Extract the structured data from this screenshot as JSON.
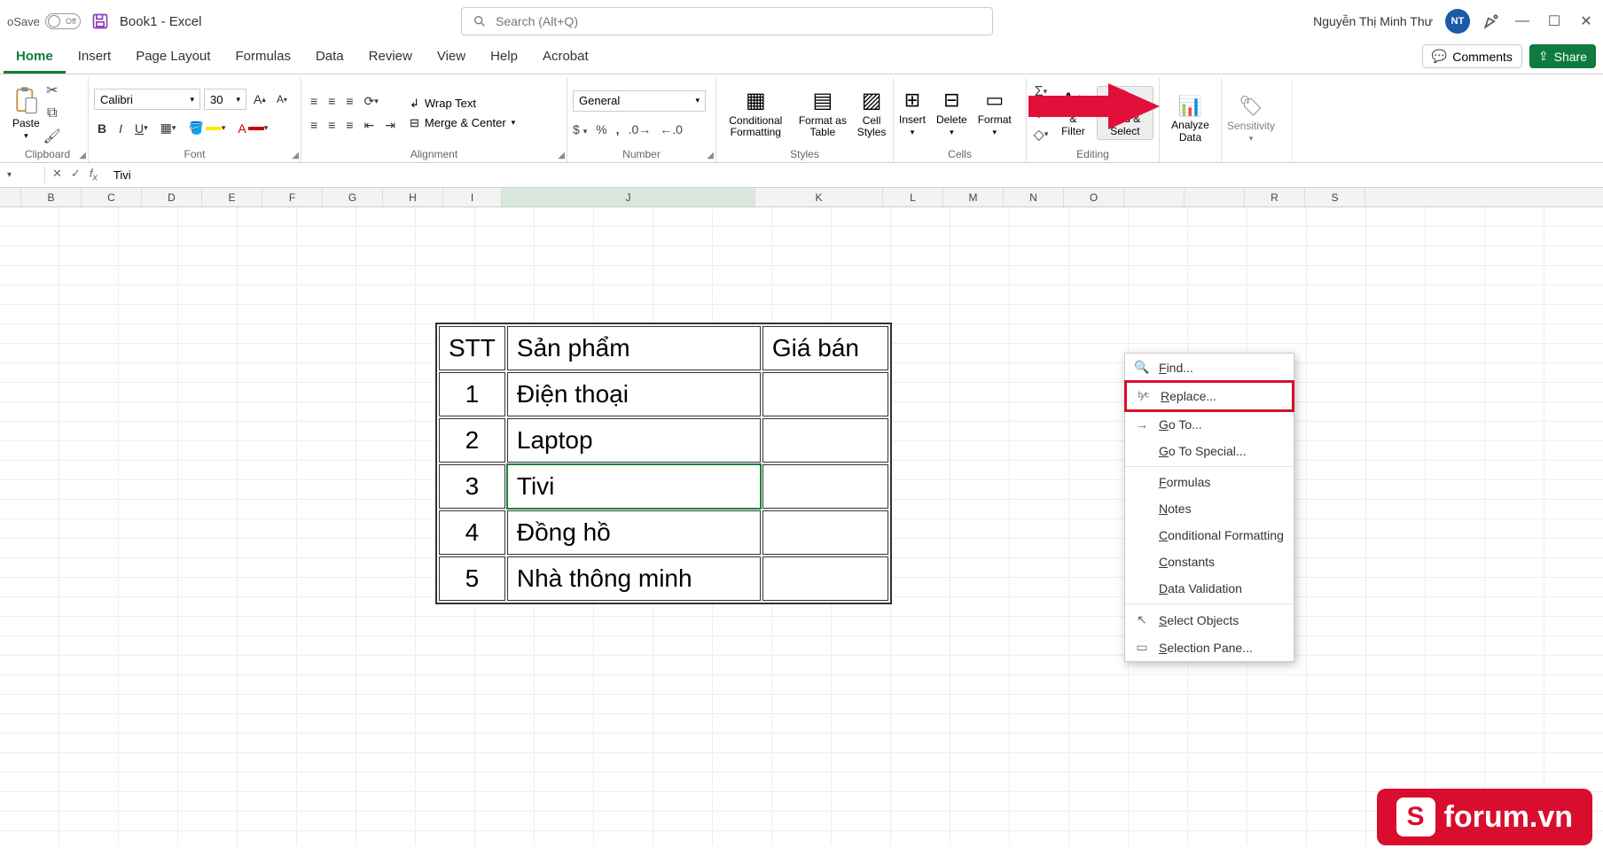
{
  "titlebar": {
    "autosave_label": "oSave",
    "autosave_state": "Off",
    "filename": "Book1  -  Excel",
    "search_placeholder": "Search (Alt+Q)",
    "user_name": "Nguyễn Thị Minh Thư",
    "user_initials": "NT"
  },
  "tabs": {
    "items": [
      "Home",
      "Insert",
      "Page Layout",
      "Formulas",
      "Data",
      "Review",
      "View",
      "Help",
      "Acrobat"
    ],
    "active": "Home",
    "comments": "Comments",
    "share": "Share"
  },
  "ribbon": {
    "clipboard": {
      "paste": "Paste",
      "label": "Clipboard"
    },
    "font": {
      "name": "Calibri",
      "size": "30",
      "label": "Font"
    },
    "alignment": {
      "wrap": "Wrap Text",
      "merge": "Merge & Center",
      "label": "Alignment"
    },
    "number": {
      "format": "General",
      "label": "Number"
    },
    "styles": {
      "cond": "Conditional Formatting",
      "table": "Format as Table",
      "cell": "Cell Styles",
      "label": "Styles"
    },
    "cells": {
      "insert": "Insert",
      "delete": "Delete",
      "format": "Format",
      "label": "Cells"
    },
    "editing": {
      "sort": "& Filter",
      "find": "Find & Select",
      "label": "Editing"
    },
    "analysis": {
      "analyze": "Analyze Data"
    },
    "sensitivity": {
      "label": "Sensitivity"
    }
  },
  "formula_bar": {
    "cell_value": "Tivi"
  },
  "columns": [
    "B",
    "C",
    "D",
    "E",
    "F",
    "G",
    "H",
    "I",
    "J",
    "K",
    "L",
    "M",
    "N",
    "O",
    "",
    "",
    "R",
    "S"
  ],
  "active_col_start": "I",
  "active_col_end": "J",
  "table": {
    "headers": {
      "stt": "STT",
      "prod": "Sản phẩm",
      "price": "Giá bán"
    },
    "rows": [
      {
        "stt": "1",
        "prod": "Điện thoại",
        "price": ""
      },
      {
        "stt": "2",
        "prod": "Laptop",
        "price": ""
      },
      {
        "stt": "3",
        "prod": "Tivi",
        "price": ""
      },
      {
        "stt": "4",
        "prod": "Đồng hồ",
        "price": ""
      },
      {
        "stt": "5",
        "prod": "Nhà thông minh",
        "price": ""
      }
    ],
    "selected_row_index": 2
  },
  "dropdown": {
    "items": [
      {
        "icon": "search",
        "label": "Find..."
      },
      {
        "icon": "replace",
        "label": "Replace...",
        "highlight": true
      },
      {
        "icon": "goto",
        "label": "Go To..."
      },
      {
        "icon": "",
        "label": "Go To Special..."
      },
      {
        "sep": true
      },
      {
        "icon": "",
        "label": "Formulas"
      },
      {
        "icon": "",
        "label": "Notes"
      },
      {
        "icon": "",
        "label": "Conditional Formatting"
      },
      {
        "icon": "",
        "label": "Constants"
      },
      {
        "icon": "",
        "label": "Data Validation"
      },
      {
        "sep": true
      },
      {
        "icon": "pointer",
        "label": "Select Objects"
      },
      {
        "icon": "pane",
        "label": "Selection Pane..."
      }
    ]
  },
  "watermark": {
    "text": "forum.vn",
    "badge": "S"
  }
}
